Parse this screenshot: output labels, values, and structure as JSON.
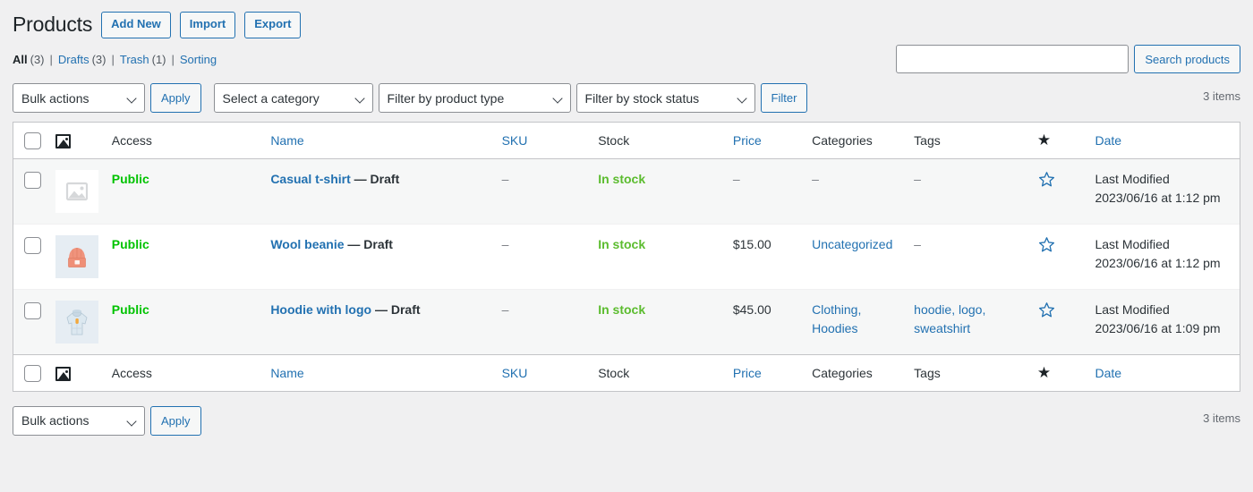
{
  "header": {
    "title": "Products",
    "actions": [
      {
        "label": "Add New",
        "name": "add-new-button"
      },
      {
        "label": "Import",
        "name": "import-button"
      },
      {
        "label": "Export",
        "name": "export-button"
      }
    ]
  },
  "views": [
    {
      "label": "All",
      "count": "(3)",
      "current": true
    },
    {
      "label": "Drafts",
      "count": "(3)",
      "current": false
    },
    {
      "label": "Trash",
      "count": "(1)",
      "current": false
    },
    {
      "label": "Sorting",
      "count": "",
      "current": false
    }
  ],
  "view_separator": "|",
  "search": {
    "value": "",
    "placeholder": "",
    "submit_label": "Search products"
  },
  "tablenav_top": {
    "bulk_actions_selected": "Bulk actions",
    "apply_label": "Apply",
    "category_selected": "Select a category",
    "product_type_selected": "Filter by product type",
    "stock_status_selected": "Filter by stock status",
    "filter_label": "Filter",
    "displaying_num": "3 items"
  },
  "tablenav_bottom": {
    "bulk_actions_selected": "Bulk actions",
    "apply_label": "Apply",
    "displaying_num": "3 items"
  },
  "columns": {
    "image": "image-icon",
    "access": "Access",
    "name": "Name",
    "sku": "SKU",
    "stock": "Stock",
    "price": "Price",
    "categories": "Categories",
    "tags": "Tags",
    "featured": "star-icon",
    "date": "Date"
  },
  "rows": [
    {
      "thumb": "placeholder-image-icon",
      "access": "Public",
      "name": "Casual t-shirt",
      "state": "— Draft",
      "sku": "–",
      "stock": "In stock",
      "price": "–",
      "categories": "–",
      "categories_is_link": false,
      "tags": "–",
      "tags_is_link": false,
      "featured": "star-outline-icon",
      "date_label": "Last Modified",
      "date_value": "2023/06/16 at 1:12 pm"
    },
    {
      "thumb": "beanie-icon",
      "access": "Public",
      "name": "Wool beanie",
      "state": "— Draft",
      "sku": "–",
      "stock": "In stock",
      "price": "$15.00",
      "categories": "Uncategorized",
      "categories_is_link": true,
      "tags": "–",
      "tags_is_link": false,
      "featured": "star-outline-icon",
      "date_label": "Last Modified",
      "date_value": "2023/06/16 at 1:12 pm"
    },
    {
      "thumb": "hoodie-icon",
      "access": "Public",
      "name": "Hoodie with logo",
      "state": "— Draft",
      "sku": "–",
      "stock": "In stock",
      "price": "$45.00",
      "categories": "Clothing, Hoodies",
      "categories_is_link": true,
      "tags": "hoodie, logo, sweatshirt",
      "tags_is_link": true,
      "featured": "star-outline-icon",
      "date_label": "Last Modified",
      "date_value": "2023/06/16 at 1:09 pm"
    }
  ],
  "colors": {
    "link": "#2271b1",
    "public_green": "#00c300",
    "instock_green": "#5bbc2e",
    "page_bg": "#f0f0f1",
    "row_alt_bg": "#f6f7f7",
    "border": "#c3c4c7"
  }
}
